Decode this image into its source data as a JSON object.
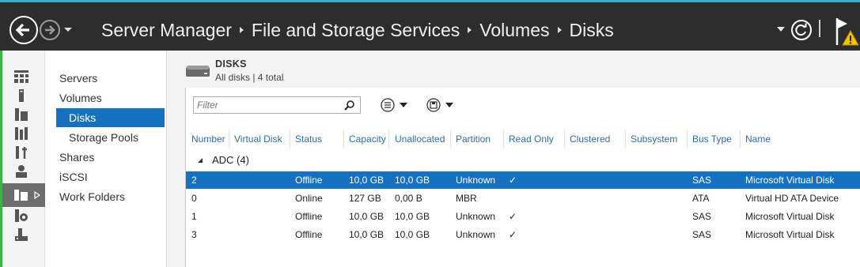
{
  "breadcrumb": [
    "Server Manager",
    "File and Storage Services",
    "Volumes",
    "Disks"
  ],
  "subnav": {
    "items": [
      {
        "label": "Servers"
      },
      {
        "label": "Volumes"
      },
      {
        "label": "Disks"
      },
      {
        "label": "Storage Pools"
      },
      {
        "label": "Shares"
      },
      {
        "label": "iSCSI"
      },
      {
        "label": "Work Folders"
      }
    ]
  },
  "panel": {
    "title": "DISKS",
    "subtitle": "All disks | 4 total",
    "filter_placeholder": "Filter"
  },
  "table": {
    "columns": [
      "Number",
      "Virtual Disk",
      "Status",
      "Capacity",
      "Unallocated",
      "Partition",
      "Read Only",
      "Clustered",
      "Subsystem",
      "Bus Type",
      "Name"
    ],
    "group": "ADC (4)",
    "rows": [
      {
        "number": "2",
        "virtual_disk": "",
        "status": "Offline",
        "capacity": "10,0 GB",
        "unallocated": "10,0 GB",
        "partition": "Unknown",
        "read_only": "✓",
        "clustered": "",
        "subsystem": "",
        "bus_type": "SAS",
        "name": "Microsoft Virtual Disk",
        "selected": true
      },
      {
        "number": "0",
        "virtual_disk": "",
        "status": "Online",
        "capacity": "127 GB",
        "unallocated": "0,00 B",
        "partition": "MBR",
        "read_only": "",
        "clustered": "",
        "subsystem": "",
        "bus_type": "ATA",
        "name": "Virtual HD ATA Device",
        "selected": false
      },
      {
        "number": "1",
        "virtual_disk": "",
        "status": "Offline",
        "capacity": "10,0 GB",
        "unallocated": "10,0 GB",
        "partition": "Unknown",
        "read_only": "✓",
        "clustered": "",
        "subsystem": "",
        "bus_type": "SAS",
        "name": "Microsoft Virtual Disk",
        "selected": false
      },
      {
        "number": "3",
        "virtual_disk": "",
        "status": "Offline",
        "capacity": "10,0 GB",
        "unallocated": "10,0 GB",
        "partition": "Unknown",
        "read_only": "✓",
        "clustered": "",
        "subsystem": "",
        "bus_type": "SAS",
        "name": "Microsoft Virtual Disk",
        "selected": false
      }
    ]
  },
  "colors": {
    "titlebar": "#2d2d2d",
    "accent": "#1672c0",
    "header_text": "#2d6ea8",
    "rail_stripe": "#3cb34a",
    "warning": "#f5c400"
  },
  "icons": {
    "back": "back-arrow-icon",
    "forward": "forward-arrow-icon",
    "refresh": "refresh-icon",
    "flag": "notification-flag-icon",
    "search": "search-icon",
    "disk": "disk-drive-icon"
  }
}
